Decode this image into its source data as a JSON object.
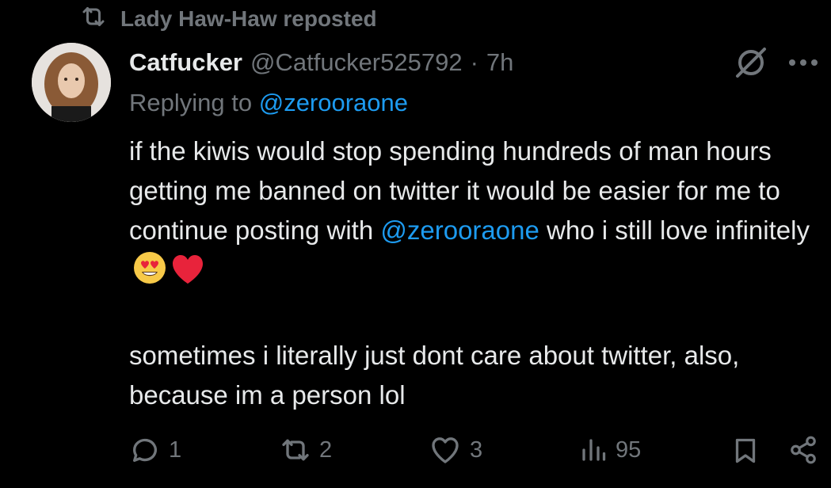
{
  "repost": {
    "icon": "repost-icon",
    "text": "Lady Haw-Haw reposted"
  },
  "tweet": {
    "avatar": "avatar",
    "display_name": "Catfucker",
    "handle": "@Catfucker525792",
    "separator": "·",
    "time": "7h",
    "reply_prefix": "Replying to ",
    "reply_to": "@zerooraone",
    "text": {
      "line1": "if the kiwis would stop spending hundreds of man hours getting me banned on twitter it would be easier for me to continue posting with ",
      "mention": "@zerooraone",
      "line2": " who i still love infinitely",
      "emojis": [
        "heart-eyes-emoji",
        "red-heart-emoji"
      ],
      "paragraph2": "sometimes i literally just dont care about twitter, also, because im a person lol"
    }
  },
  "actions": {
    "reply_count": "1",
    "repost_count": "2",
    "like_count": "3",
    "views_count": "95"
  },
  "colors": {
    "background": "#000000",
    "text": "#e7e9ea",
    "secondary": "#71767b",
    "link": "#1d9bf0"
  }
}
